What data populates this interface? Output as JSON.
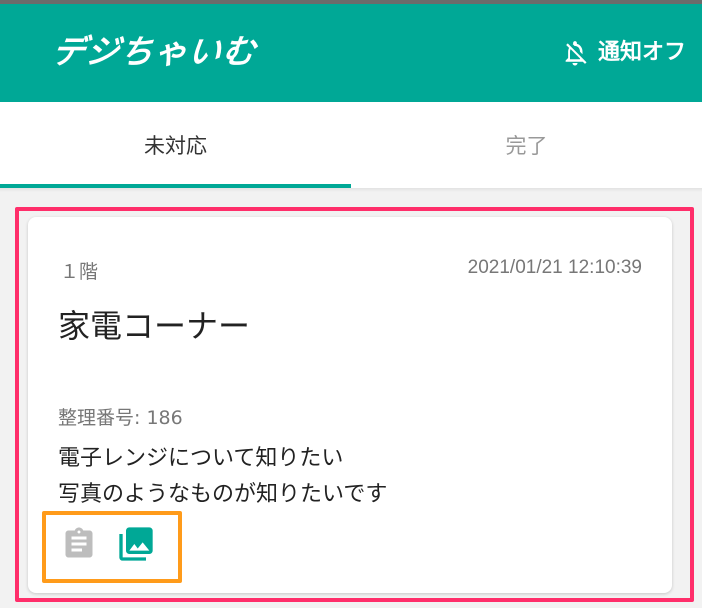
{
  "app": {
    "logo_text": "デジちゃいむ",
    "notification_label": "通知オフ",
    "colors": {
      "primary": "#00a896",
      "highlight_red": "#ff2e6a",
      "highlight_orange": "#ff9b1a"
    }
  },
  "tabs": [
    {
      "label": "未対応",
      "active": true
    },
    {
      "label": "完了",
      "active": false
    }
  ],
  "card": {
    "floor": "１階",
    "datetime": "2021/01/21 12:10:39",
    "title": "家電コーナー",
    "reference": "整理番号: 186",
    "message_line1": "電子レンジについて知りたい",
    "message_line2": "写真のようなものが知りたいです",
    "icons": [
      "clipboard-icon",
      "photo-library-icon"
    ]
  }
}
